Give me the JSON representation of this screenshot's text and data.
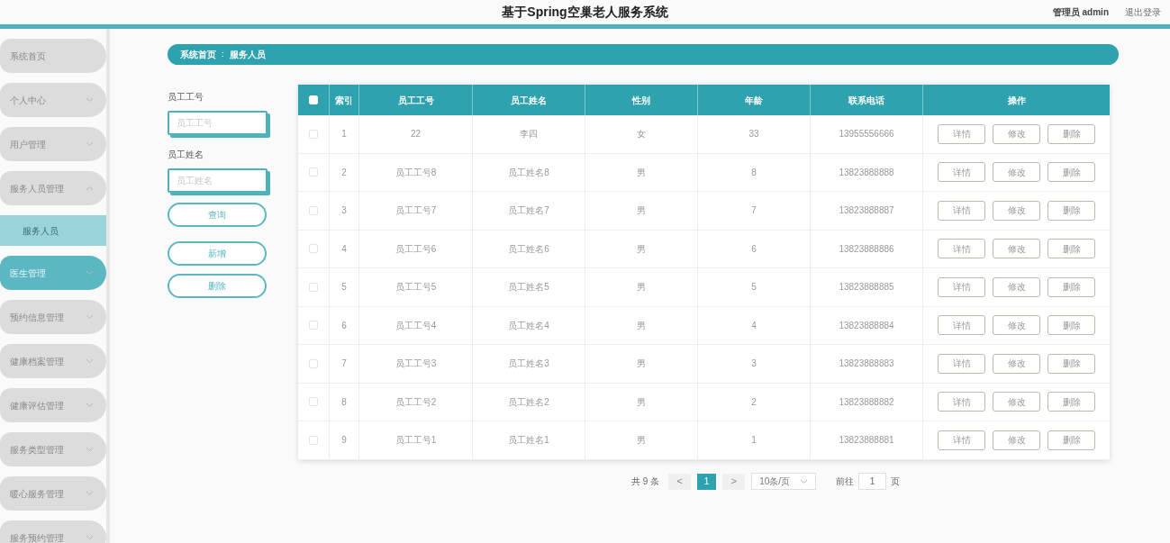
{
  "header": {
    "title": "基于Spring空巢老人服务系统",
    "user": "管理员 admin",
    "logout": "退出登录"
  },
  "sidebar": {
    "items": [
      {
        "label": "系统首页",
        "kind": "link",
        "selected": false
      },
      {
        "label": "个人中心",
        "kind": "menu",
        "selected": false,
        "expanded": false
      },
      {
        "label": "用户管理",
        "kind": "menu",
        "selected": false,
        "expanded": false
      },
      {
        "label": "服务人员管理",
        "kind": "menu",
        "selected": false,
        "expanded": true,
        "children": [
          {
            "label": "服务人员",
            "selected": true
          }
        ]
      },
      {
        "label": "医生管理",
        "kind": "menu",
        "selected": true,
        "expanded": false
      },
      {
        "label": "预约信息管理",
        "kind": "menu",
        "selected": false,
        "expanded": false
      },
      {
        "label": "健康档案管理",
        "kind": "menu",
        "selected": false,
        "expanded": false
      },
      {
        "label": "健康评估管理",
        "kind": "menu",
        "selected": false,
        "expanded": false
      },
      {
        "label": "服务类型管理",
        "kind": "menu",
        "selected": false,
        "expanded": false
      },
      {
        "label": "暖心服务管理",
        "kind": "menu",
        "selected": false,
        "expanded": false
      },
      {
        "label": "服务预约管理",
        "kind": "menu",
        "selected": false,
        "expanded": false
      }
    ]
  },
  "breadcrumb": {
    "items": [
      "系统首页",
      "服务人员"
    ],
    "separator": "∶"
  },
  "search": {
    "fields": [
      {
        "label": "员工工号",
        "placeholder": "员工工号"
      },
      {
        "label": "员工姓名",
        "placeholder": "员工姓名"
      }
    ],
    "buttons": [
      "查询",
      "新增",
      "删除"
    ]
  },
  "table": {
    "select_all": {
      "checked": false
    },
    "columns": [
      "索引",
      "员工工号",
      "员工姓名",
      "性别",
      "年龄",
      "联系电话",
      "操作"
    ],
    "rows": [
      {
        "checked": false,
        "cells": [
          "1",
          "22",
          "李四",
          "女",
          "33",
          "13955556666"
        ],
        "actions": [
          "详情",
          "修改",
          "删除"
        ]
      },
      {
        "checked": false,
        "cells": [
          "2",
          "员工工号8",
          "员工姓名8",
          "男",
          "8",
          "13823888888"
        ],
        "actions": [
          "详情",
          "修改",
          "删除"
        ]
      },
      {
        "checked": false,
        "cells": [
          "3",
          "员工工号7",
          "员工姓名7",
          "男",
          "7",
          "13823888887"
        ],
        "actions": [
          "详情",
          "修改",
          "删除"
        ]
      },
      {
        "checked": false,
        "cells": [
          "4",
          "员工工号6",
          "员工姓名6",
          "男",
          "6",
          "13823888886"
        ],
        "actions": [
          "详情",
          "修改",
          "删除"
        ]
      },
      {
        "checked": false,
        "cells": [
          "5",
          "员工工号5",
          "员工姓名5",
          "男",
          "5",
          "13823888885"
        ],
        "actions": [
          "详情",
          "修改",
          "删除"
        ]
      },
      {
        "checked": false,
        "cells": [
          "6",
          "员工工号4",
          "员工姓名4",
          "男",
          "4",
          "13823888884"
        ],
        "actions": [
          "详情",
          "修改",
          "删除"
        ]
      },
      {
        "checked": false,
        "cells": [
          "7",
          "员工工号3",
          "员工姓名3",
          "男",
          "3",
          "13823888883"
        ],
        "actions": [
          "详情",
          "修改",
          "删除"
        ]
      },
      {
        "checked": false,
        "cells": [
          "8",
          "员工工号2",
          "员工姓名2",
          "男",
          "2",
          "13823888882"
        ],
        "actions": [
          "详情",
          "修改",
          "删除"
        ]
      },
      {
        "checked": false,
        "cells": [
          "9",
          "员工工号1",
          "员工姓名1",
          "男",
          "1",
          "13823888881"
        ],
        "actions": [
          "详情",
          "修改",
          "删除"
        ]
      }
    ]
  },
  "pagination": {
    "total": "共 9 条",
    "prev": "<",
    "pages": [
      {
        "label": "1",
        "selected": true
      }
    ],
    "next": ">",
    "page_size": "10条/页",
    "goto_label": "前往",
    "goto_value": "1",
    "goto_suffix": "页"
  }
}
